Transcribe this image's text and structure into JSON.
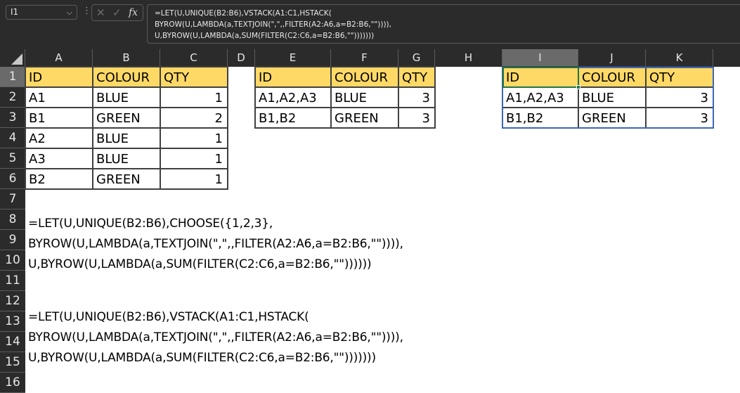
{
  "formula_bar": {
    "name_box": "I1",
    "cancel_icon": "✕",
    "enter_icon": "✓",
    "fx_label": "fx",
    "formula_lines": [
      "=LET(U,UNIQUE(B2:B6),VSTACK(A1:C1,HSTACK(",
      "BYROW(U,LAMBDA(a,TEXTJOIN(\",\",,FILTER(A2:A6,a=B2:B6,\"\")))),",
      "U,BYROW(U,LAMBDA(a,SUM(FILTER(C2:C6,a=B2:B6,\"\")))))))"
    ]
  },
  "columns": [
    "A",
    "B",
    "C",
    "D",
    "E",
    "F",
    "G",
    "H",
    "I",
    "J",
    "K"
  ],
  "selected_column": "I",
  "rows": [
    "1",
    "2",
    "3",
    "4",
    "5",
    "6",
    "7",
    "8",
    "9",
    "10",
    "11",
    "12",
    "13",
    "14",
    "15",
    "16"
  ],
  "selected_row": "1",
  "source_table": {
    "headers": [
      "ID",
      "COLOUR",
      "QTY"
    ],
    "rows": [
      [
        "A1",
        "BLUE",
        "1"
      ],
      [
        "B1",
        "GREEN",
        "2"
      ],
      [
        "A2",
        "BLUE",
        "1"
      ],
      [
        "A3",
        "BLUE",
        "1"
      ],
      [
        "B2",
        "GREEN",
        "1"
      ]
    ]
  },
  "result_table_choose": {
    "headers": [
      "ID",
      "COLOUR",
      "QTY"
    ],
    "rows": [
      [
        "A1,A2,A3",
        "BLUE",
        "3"
      ],
      [
        "B1,B2",
        "GREEN",
        "3"
      ]
    ]
  },
  "result_table_vstack": {
    "headers": [
      "ID",
      "COLOUR",
      "QTY"
    ],
    "rows": [
      [
        "A1,A2,A3",
        "BLUE",
        "3"
      ],
      [
        "B1,B2",
        "GREEN",
        "3"
      ]
    ]
  },
  "formula_text_choose": [
    "=LET(U,UNIQUE(B2:B6),CHOOSE({1,2,3},",
    "BYROW(U,LAMBDA(a,TEXTJOIN(\",\",,FILTER(A2:A6,a=B2:B6,\"\")))),",
    "U,BYROW(U,LAMBDA(a,SUM(FILTER(C2:C6,a=B2:B6,\"\"))))))"
  ],
  "formula_text_vstack": [
    "=LET(U,UNIQUE(B2:B6),VSTACK(A1:C1,HSTACK(",
    "BYROW(U,LAMBDA(a,TEXTJOIN(\",\",,FILTER(A2:A6,a=B2:B6,\"\")))),",
    "U,BYROW(U,LAMBDA(a,SUM(FILTER(C2:C6,a=B2:B6,\"\")))))))"
  ]
}
